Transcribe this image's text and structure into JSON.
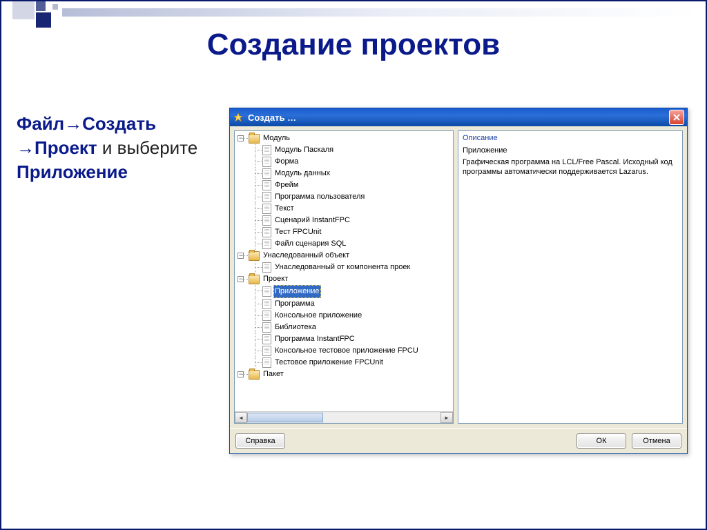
{
  "slide": {
    "title": "Создание проектов",
    "instruction": {
      "bold1": "Файл→Создать",
      "bold2": "→Проект",
      "plain1": " и выберите ",
      "bold3": "Приложение"
    }
  },
  "dialog": {
    "title": "Создать …",
    "help_button": "Справка",
    "ok_button": "ОК",
    "cancel_button": "Отмена"
  },
  "tree": {
    "groups": [
      {
        "label": "Модуль",
        "expanded": true,
        "items": [
          "Модуль Паскаля",
          "Форма",
          "Модуль данных",
          "Фрейм",
          "Программа пользователя",
          "Текст",
          "Сценарий InstantFPC",
          "Тест FPCUnit",
          "Файл сценария SQL"
        ]
      },
      {
        "label": "Унаследованный объект",
        "expanded": true,
        "items": [
          "Унаследованный от компонента проек"
        ]
      },
      {
        "label": "Проект",
        "expanded": true,
        "items": [
          "Приложение",
          "Программа",
          "Консольное приложение",
          "Библиотека",
          "Программа InstantFPC",
          "Консольное тестовое приложение FPCU",
          "Тестовое приложение FPCUnit"
        ]
      },
      {
        "label": "Пакет",
        "expanded": true,
        "items": []
      }
    ],
    "selected": "Приложение"
  },
  "description": {
    "heading": "Описание",
    "name": "Приложение",
    "body": "Графическая программа на LCL/Free Pascal. Исходный код программы автоматически поддерживается Lazarus."
  }
}
